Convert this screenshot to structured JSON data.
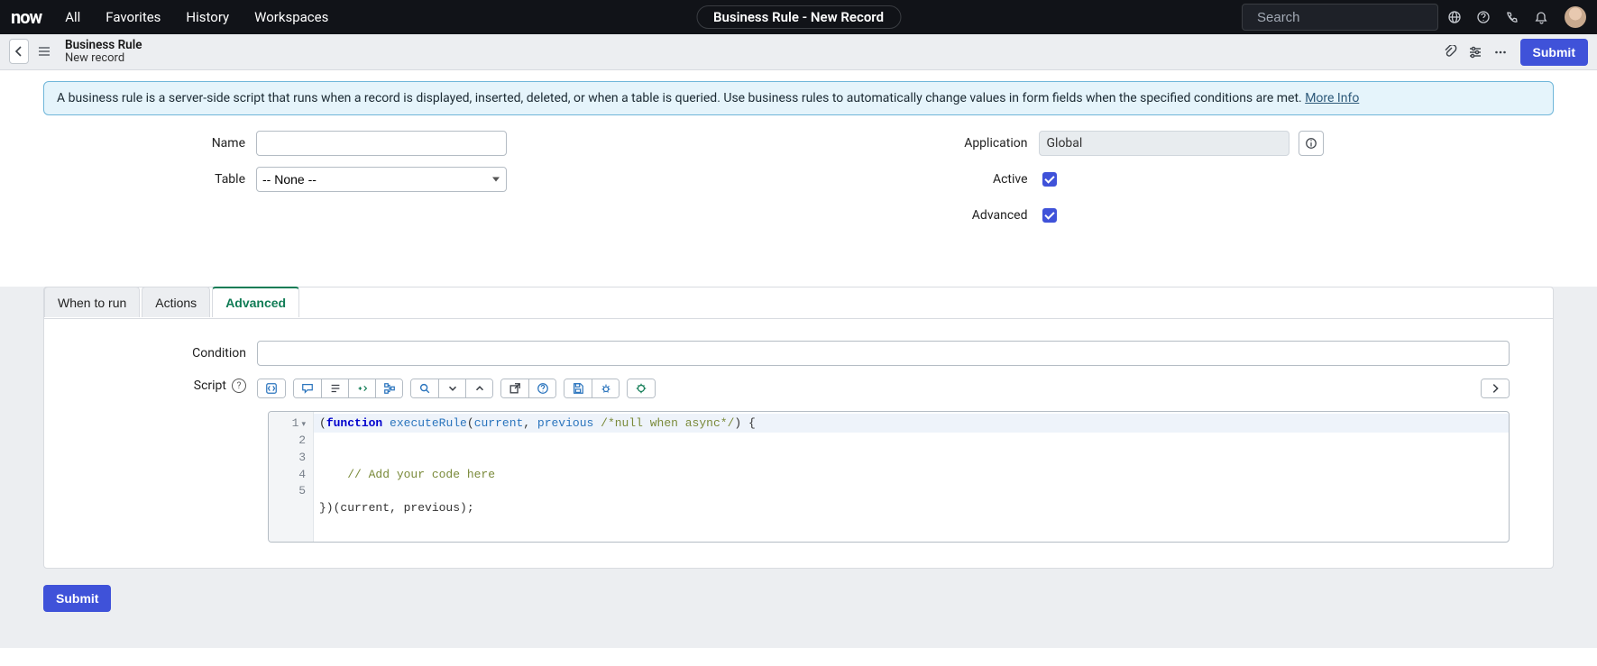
{
  "topbar": {
    "logo": "now",
    "nav": [
      "All",
      "Favorites",
      "History",
      "Workspaces"
    ],
    "context_title": "Business Rule - New Record",
    "search_placeholder": "Search"
  },
  "subheader": {
    "title": "Business Rule",
    "subtitle": "New record",
    "submit_label": "Submit"
  },
  "info": {
    "text": "A business rule is a server-side script that runs when a record is displayed, inserted, deleted, or when a table is queried. Use business rules to automatically change values in form fields when the specified conditions are met. ",
    "link_label": "More Info"
  },
  "form": {
    "name_label": "Name",
    "name_value": "",
    "table_label": "Table",
    "table_value": "-- None --",
    "application_label": "Application",
    "application_value": "Global",
    "active_label": "Active",
    "active_checked": true,
    "advanced_label": "Advanced",
    "advanced_checked": true
  },
  "tabs": {
    "items": [
      {
        "label": "When to run",
        "active": false
      },
      {
        "label": "Actions",
        "active": false
      },
      {
        "label": "Advanced",
        "active": true
      }
    ]
  },
  "advanced": {
    "condition_label": "Condition",
    "condition_value": "",
    "script_label": "Script",
    "script": {
      "line_numbers": [
        "1",
        "2",
        "3",
        "4",
        "5"
      ],
      "line1_keyword": "function",
      "line1_open": "(",
      "line1_name": "executeRule",
      "line1_paren_open": "(",
      "line1_arg1": "current",
      "line1_comma": ", ",
      "line1_arg2": "previous",
      "line1_space": " ",
      "line1_cmt": "/*null when async*/",
      "line1_close": ") {",
      "line3_cmt": "    // Add your code here",
      "line5": "})(current, previous);"
    }
  },
  "footer": {
    "submit_label": "Submit"
  }
}
